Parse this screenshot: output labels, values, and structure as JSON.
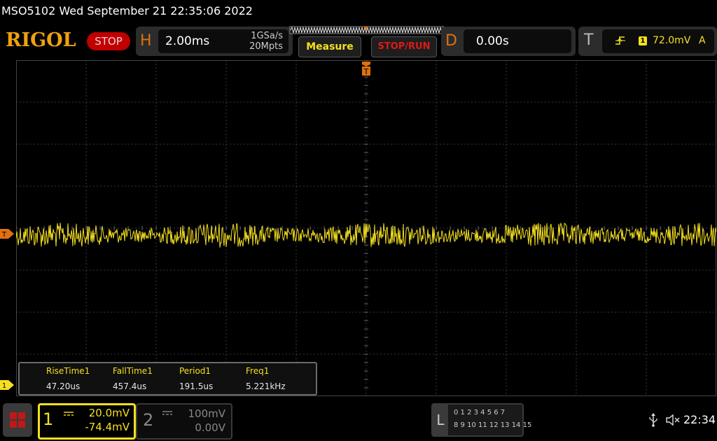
{
  "header": {
    "title": "MSO5102  Wed September 21 22:35:06 2022",
    "logo": "RIGOL",
    "run_status": "STOP"
  },
  "horizontal": {
    "letter": "H",
    "timebase": "2.00ms",
    "sample_rate": "1GSa/s",
    "memory_depth": "20Mpts"
  },
  "buttons": {
    "measure": "Measure",
    "stop_run": "STOP/RUN"
  },
  "delay": {
    "letter": "D",
    "value": "0.00s"
  },
  "trigger": {
    "letter": "T",
    "edge_icon": "rising-edge-icon",
    "channel": "1",
    "level": "72.0mV",
    "mode": "A",
    "position_marker": "T",
    "level_marker": "T"
  },
  "measurements": [
    {
      "label": "RiseTime1",
      "value": "47.20us"
    },
    {
      "label": "FallTime1",
      "value": "457.4us"
    },
    {
      "label": "Period1",
      "value": "191.5us"
    },
    {
      "label": "Freq1",
      "value": "5.221kHz"
    }
  ],
  "channels": {
    "ch1": {
      "number": "1",
      "scale": "20.0mV",
      "offset": "-74.4mV",
      "ground_marker": "1",
      "color": "#f5e020"
    },
    "ch2": {
      "number": "2",
      "scale": "100mV",
      "offset": "0.00V",
      "color": "#888888"
    }
  },
  "logic_analyzer": {
    "letter": "L",
    "row1": "0 1 2 3   4 5 6 7",
    "row2": "8 9 10 11 12 13 14 15"
  },
  "status_bar": {
    "usb_icon": "usb-icon",
    "speaker_icon": "speaker-muted-icon",
    "clock": "22:34"
  },
  "colors": {
    "trace": "#f5e020",
    "accent_orange": "#e07010",
    "stop_red": "#c00000"
  }
}
